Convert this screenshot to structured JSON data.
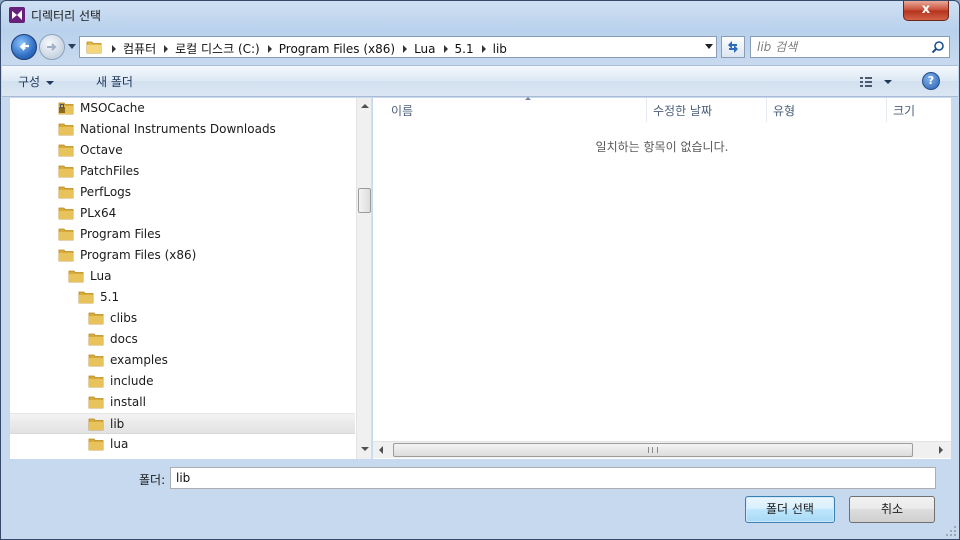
{
  "window": {
    "title": "디렉터리 선택",
    "close_label": "x"
  },
  "address": {
    "crumbs": [
      "컴퓨터",
      "로컬 디스크 (C:)",
      "Program Files (x86)",
      "Lua",
      "5.1",
      "lib"
    ],
    "search_placeholder": "lib 검색"
  },
  "toolbar": {
    "organize_label": "구성",
    "new_folder_label": "새 폴더",
    "help_label": "?"
  },
  "tree": {
    "items": [
      {
        "label": "MSOCache",
        "depth": 0,
        "locked": true
      },
      {
        "label": "National Instruments Downloads",
        "depth": 0
      },
      {
        "label": "Octave",
        "depth": 0
      },
      {
        "label": "PatchFiles",
        "depth": 0
      },
      {
        "label": "PerfLogs",
        "depth": 0
      },
      {
        "label": "PLx64",
        "depth": 0
      },
      {
        "label": "Program Files",
        "depth": 0
      },
      {
        "label": "Program Files (x86)",
        "depth": 0
      },
      {
        "label": "Lua",
        "depth": 1
      },
      {
        "label": "5.1",
        "depth": 2
      },
      {
        "label": "clibs",
        "depth": 3
      },
      {
        "label": "docs",
        "depth": 3
      },
      {
        "label": "examples",
        "depth": 3
      },
      {
        "label": "include",
        "depth": 3
      },
      {
        "label": "install",
        "depth": 3
      },
      {
        "label": "lib",
        "depth": 3,
        "selected": true
      },
      {
        "label": "lua",
        "depth": 3
      }
    ]
  },
  "files": {
    "columns": [
      "이름",
      "수정한 날짜",
      "유형",
      "크기"
    ],
    "empty_message": "일치하는 항목이 없습니다."
  },
  "footer": {
    "folder_label": "폴더:",
    "folder_value": "lib",
    "select_label": "폴더 선택",
    "cancel_label": "취소"
  },
  "colors": {
    "folder": "#e8c25a",
    "accent": "#3c7fb1",
    "app_icon": "#68217a"
  }
}
